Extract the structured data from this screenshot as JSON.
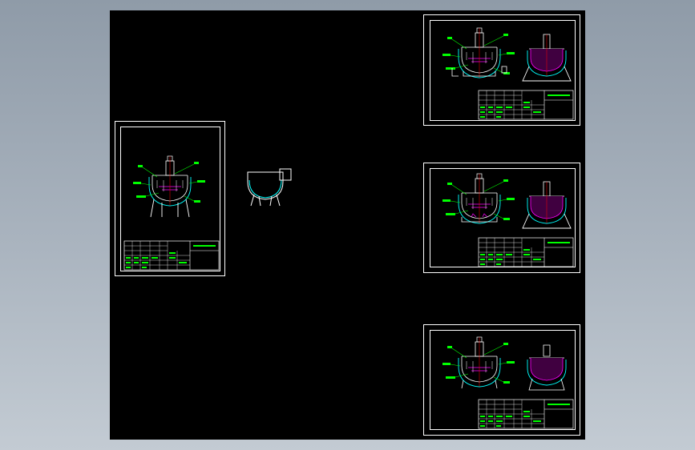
{
  "viewport": {
    "background": "#000000"
  },
  "colors": {
    "frame": "#ffffff",
    "callout": "#00ff00",
    "jacket": "#00ffff",
    "accent": "#ff00ff",
    "center_line": "#ff0000",
    "paper_bg": "#8f9ba8"
  },
  "sheets": [
    {
      "id": "sheet-left",
      "kind": "portrait-drawing"
    },
    {
      "id": "sheet-top-right",
      "kind": "landscape-drawing"
    },
    {
      "id": "sheet-middle-right",
      "kind": "landscape-drawing"
    },
    {
      "id": "sheet-bottom-right",
      "kind": "landscape-drawing"
    }
  ],
  "loose_block": {
    "id": "kettle-side-view",
    "icon": "kettle-icon"
  }
}
